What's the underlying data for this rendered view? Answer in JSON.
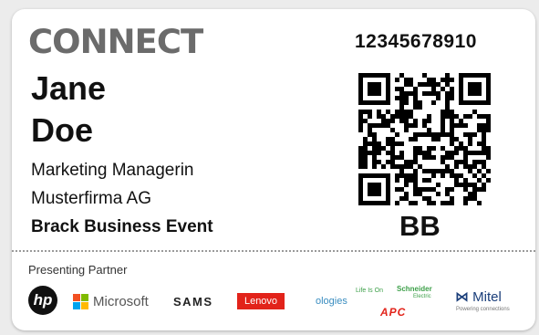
{
  "badge": {
    "logo_text": "CONNECT",
    "first_name": "Jane",
    "last_name": "Doe",
    "job_title": "Marketing Managerin",
    "company": "Musterfirma AG",
    "event_name": "Brack Business Event",
    "ticket_number": "12345678910",
    "attendee_code": "BB"
  },
  "partners": {
    "label": "Presenting Partner",
    "hp": "hp",
    "microsoft": "Microsoft",
    "samsung": "SAMS",
    "lenovo": "Lenovo",
    "ologies": "ologies",
    "life_is_on": "Life Is On",
    "schneider": "Schneider",
    "schneider_sub": "Electric",
    "apc": "APC",
    "mitel": "Mitel",
    "mitel_tagline": "Powering connections"
  },
  "colors": {
    "logo_gray": "#6b6b6b",
    "lenovo_red": "#e2231a",
    "schneider_green": "#3ea04a",
    "mitel_blue": "#1a3e7a",
    "ms_red": "#f25022",
    "ms_green": "#7fba00",
    "ms_blue": "#00a4ef",
    "ms_yellow": "#ffb900"
  },
  "icons": {
    "qr": "qr-code-icon",
    "hp": "hp-logo-icon",
    "microsoft": "microsoft-logo-icon",
    "mitel": "mitel-logo-icon"
  }
}
